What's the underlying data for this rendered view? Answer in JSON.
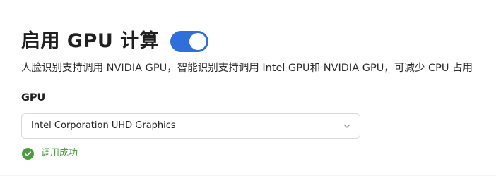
{
  "header": {
    "title": "启用 GPU 计算",
    "toggle_state": "on",
    "accent_color": "#2f6fdc"
  },
  "description": "人脸识别支持调用 NVIDIA GPU，智能识别支持调用 Intel GPU和 NVIDIA GPU，可减少 CPU 占用",
  "gpu_field": {
    "label": "GPU",
    "selected_value": "Intel Corporation UHD Graphics",
    "dropdown_icon": "chevron-down-icon"
  },
  "status": {
    "icon": "check-circle-icon",
    "text": "调用成功",
    "color": "#4a9d3f"
  }
}
